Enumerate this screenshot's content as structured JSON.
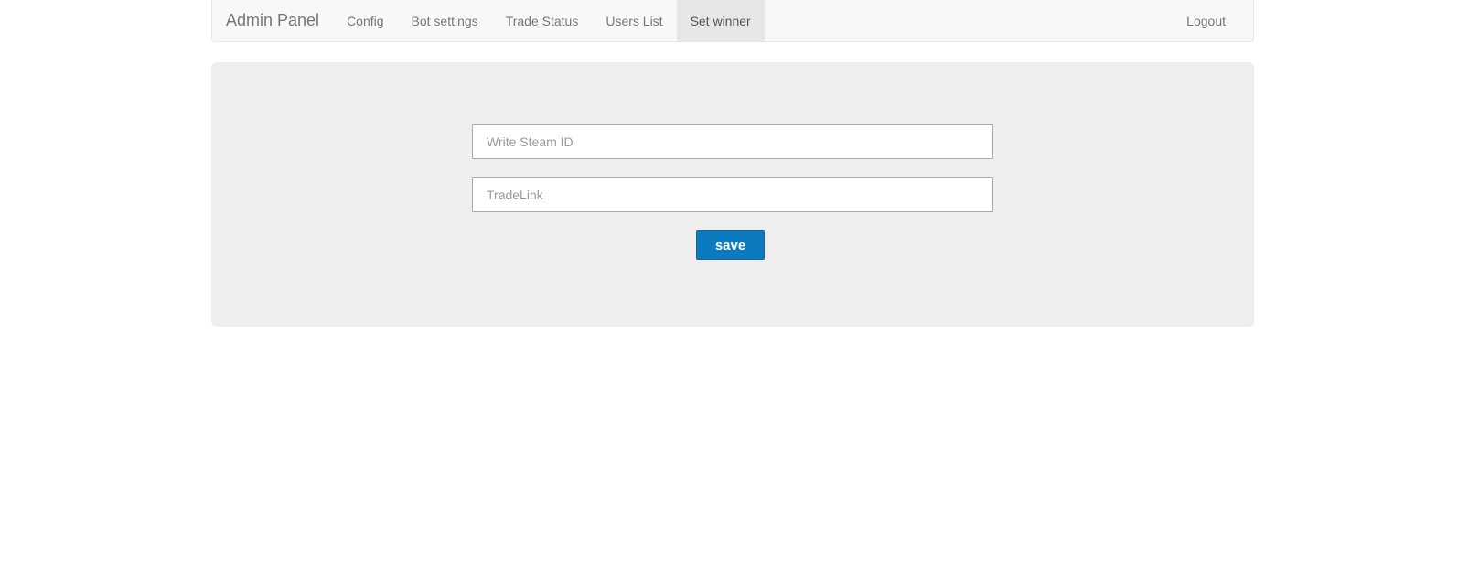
{
  "navbar": {
    "brand": "Admin Panel",
    "items": [
      {
        "label": "Config",
        "active": false
      },
      {
        "label": "Bot settings",
        "active": false
      },
      {
        "label": "Trade Status",
        "active": false
      },
      {
        "label": "Users List",
        "active": false
      },
      {
        "label": "Set winner",
        "active": true
      }
    ],
    "logout": "Logout"
  },
  "form": {
    "steam_id": {
      "value": "",
      "placeholder": "Write Steam ID"
    },
    "trade_link": {
      "value": "",
      "placeholder": "TradeLink"
    },
    "save_label": "save"
  },
  "colors": {
    "accent": "#0b7abe",
    "navbar_bg": "#f8f8f8",
    "panel_bg": "#eeeeee",
    "active_tab_bg": "#e7e7e7"
  }
}
